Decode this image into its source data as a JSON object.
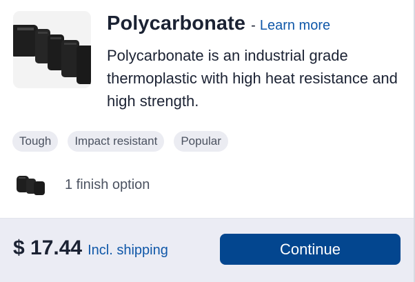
{
  "product": {
    "title": "Polycarbonate",
    "separator": "-",
    "learn_more_label": "Learn more",
    "description": "Polycarbonate is an industrial grade thermoplastic with high heat resistance and high strength.",
    "thumbnail_icon": "black-plastic-part-image"
  },
  "tags": [
    "Tough",
    "Impact resistant",
    "Popular"
  ],
  "finish": {
    "label": "1 finish option",
    "thumbnail_icon": "finish-swatch-image"
  },
  "footer": {
    "price": "$ 17.44",
    "shipping_label": "Incl. shipping",
    "continue_label": "Continue"
  },
  "colors": {
    "accent": "#03468f",
    "link": "#0f57a8",
    "text": "#1b2233",
    "tag_bg": "#ebecf2",
    "footer_bg": "#ebecf4"
  }
}
